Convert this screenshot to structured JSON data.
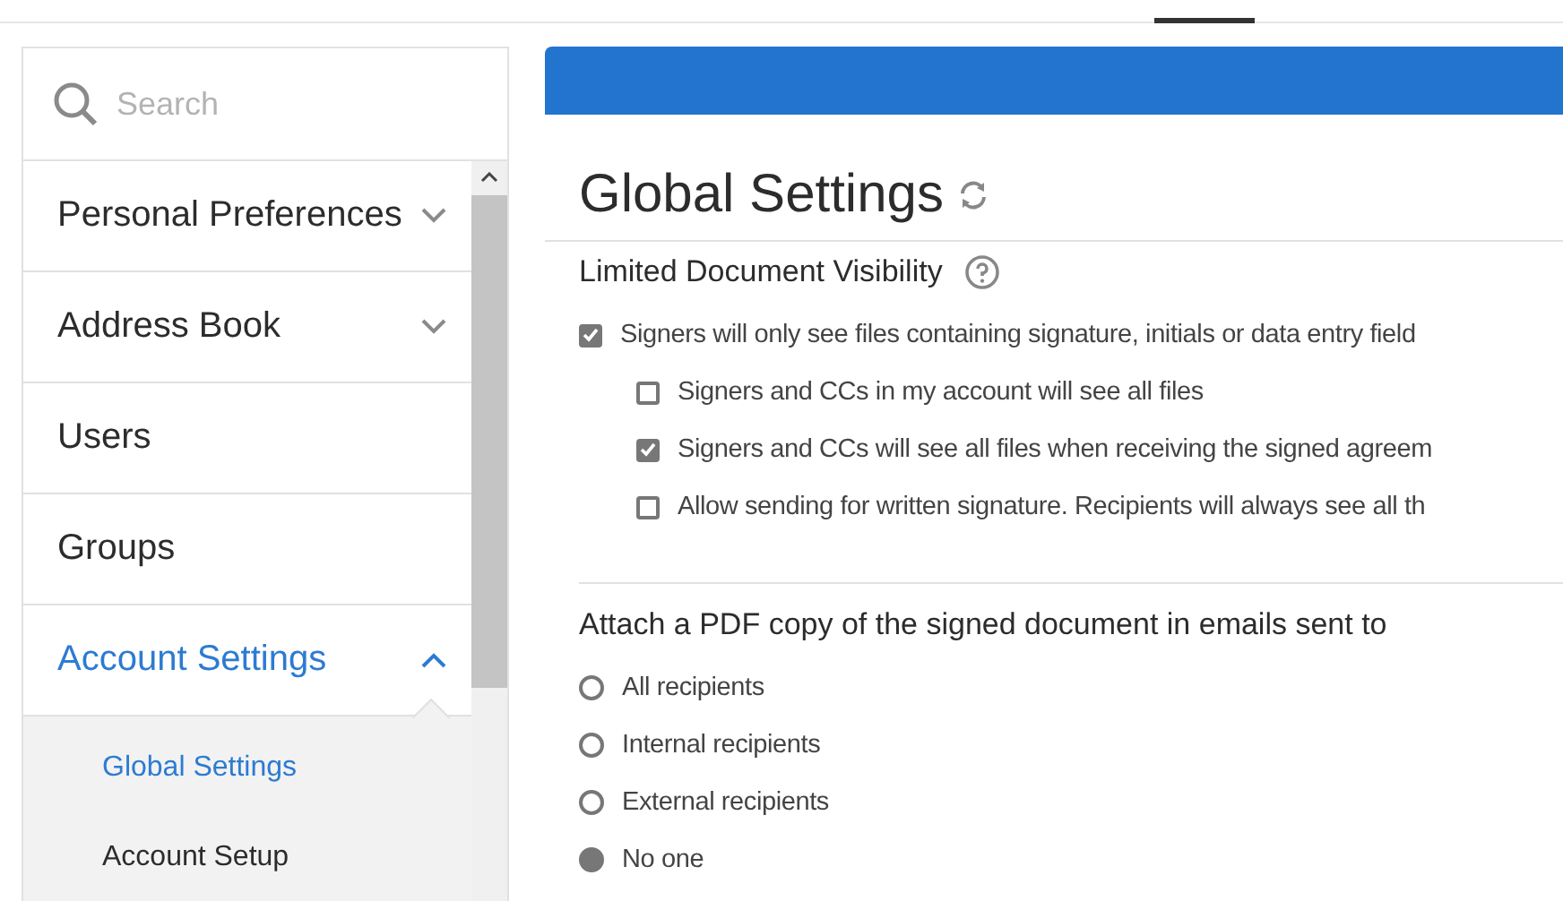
{
  "search": {
    "placeholder": "Search"
  },
  "nav": [
    {
      "label": "Personal Preferences",
      "expanded": false,
      "selected": false
    },
    {
      "label": "Address Book",
      "expanded": false,
      "selected": false
    },
    {
      "label": "Users",
      "selected": false
    },
    {
      "label": "Groups",
      "selected": false
    },
    {
      "label": "Account Settings",
      "expanded": true,
      "selected": true,
      "children": [
        {
          "label": "Global Settings",
          "selected": true
        },
        {
          "label": "Account Setup",
          "selected": false
        }
      ]
    }
  ],
  "page": {
    "title": "Global Settings"
  },
  "sections": [
    {
      "kind": "checkboxes",
      "heading": "Limited Document Visibility",
      "options": [
        {
          "label": "Signers will only see files containing signature, initials or data entry field",
          "checked": true,
          "children": [
            {
              "label": "Signers and CCs in my account will see all files",
              "checked": false
            },
            {
              "label": "Signers and CCs will see all files when receiving the signed agreem",
              "checked": true
            },
            {
              "label": "Allow sending for written signature. Recipients will always see all th",
              "checked": false
            }
          ]
        }
      ]
    },
    {
      "kind": "radios",
      "heading": "Attach a PDF copy of the signed document in emails sent to",
      "options": [
        {
          "label": "All recipients",
          "selected": false
        },
        {
          "label": "Internal recipients",
          "selected": false
        },
        {
          "label": "External recipients",
          "selected": false
        },
        {
          "label": "No one",
          "selected": true
        }
      ]
    }
  ]
}
